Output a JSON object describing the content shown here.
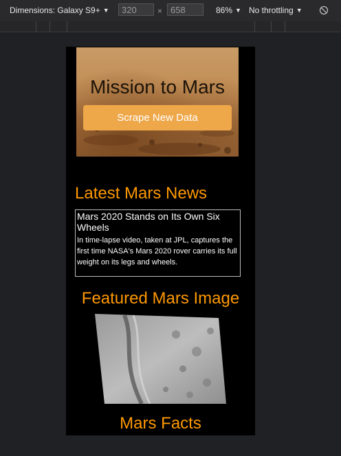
{
  "toolbar": {
    "dimensions_label": "Dimensions: Galaxy S9+",
    "width_value": "320",
    "height_value": "658",
    "times_symbol": "×",
    "zoom": "86%",
    "throttling": "No throttling",
    "icons": {
      "dropdown": "caret-down-icon",
      "rotate": "rotate-icon"
    }
  },
  "page": {
    "hero": {
      "title": "Mission to Mars",
      "button_label": "Scrape New Data"
    },
    "news": {
      "heading": "Latest Mars News",
      "title": "Mars 2020 Stands on Its Own Six Wheels",
      "paragraph": "In time-lapse video, taken at JPL, captures the first time NASA's Mars 2020 rover carries its full weight on its legs and wheels."
    },
    "featured_image": {
      "heading": "Featured Mars Image"
    },
    "facts": {
      "heading": "Mars Facts"
    }
  },
  "colors": {
    "accent": "#ff9900",
    "button": "#eea84a",
    "page_background": "#000000",
    "devtools_background": "#202124"
  }
}
